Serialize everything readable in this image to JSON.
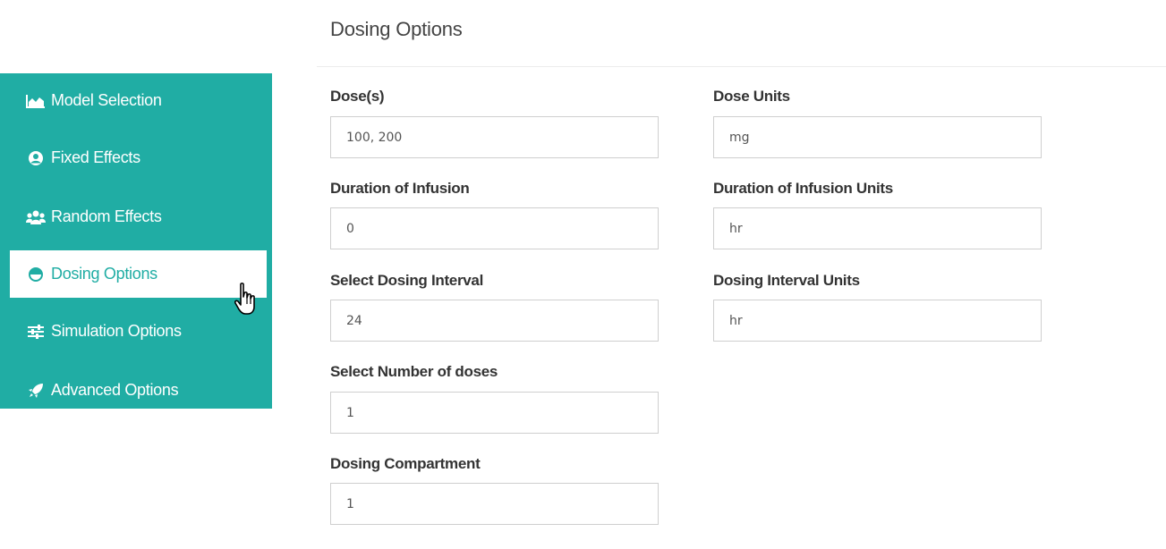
{
  "sidebar": {
    "items": [
      {
        "label": "Model Selection",
        "icon": "area-chart-icon"
      },
      {
        "label": "Fixed Effects",
        "icon": "user-circle-icon"
      },
      {
        "label": "Random Effects",
        "icon": "users-icon"
      },
      {
        "label": "Dosing Options",
        "icon": "half-circle-icon",
        "active": true
      },
      {
        "label": "Simulation Options",
        "icon": "sliders-icon"
      },
      {
        "label": "Advanced Options",
        "icon": "rocket-icon"
      }
    ],
    "colors": {
      "background": "#20ada4",
      "active_background": "#ffffff",
      "active_text": "#20ada4"
    }
  },
  "main": {
    "title": "Dosing Options",
    "fields": {
      "doses": {
        "label": "Dose(s)",
        "value": "100, 200"
      },
      "dose_units": {
        "label": "Dose Units",
        "value": "mg"
      },
      "duration": {
        "label": "Duration of Infusion",
        "value": "0"
      },
      "duration_units": {
        "label": "Duration of Infusion Units",
        "value": "hr"
      },
      "interval": {
        "label": "Select Dosing Interval",
        "value": "24"
      },
      "interval_units": {
        "label": "Dosing Interval Units",
        "value": "hr"
      },
      "num_doses": {
        "label": "Select Number of doses",
        "value": "1"
      },
      "compartment": {
        "label": "Dosing Compartment",
        "value": "1"
      }
    }
  }
}
